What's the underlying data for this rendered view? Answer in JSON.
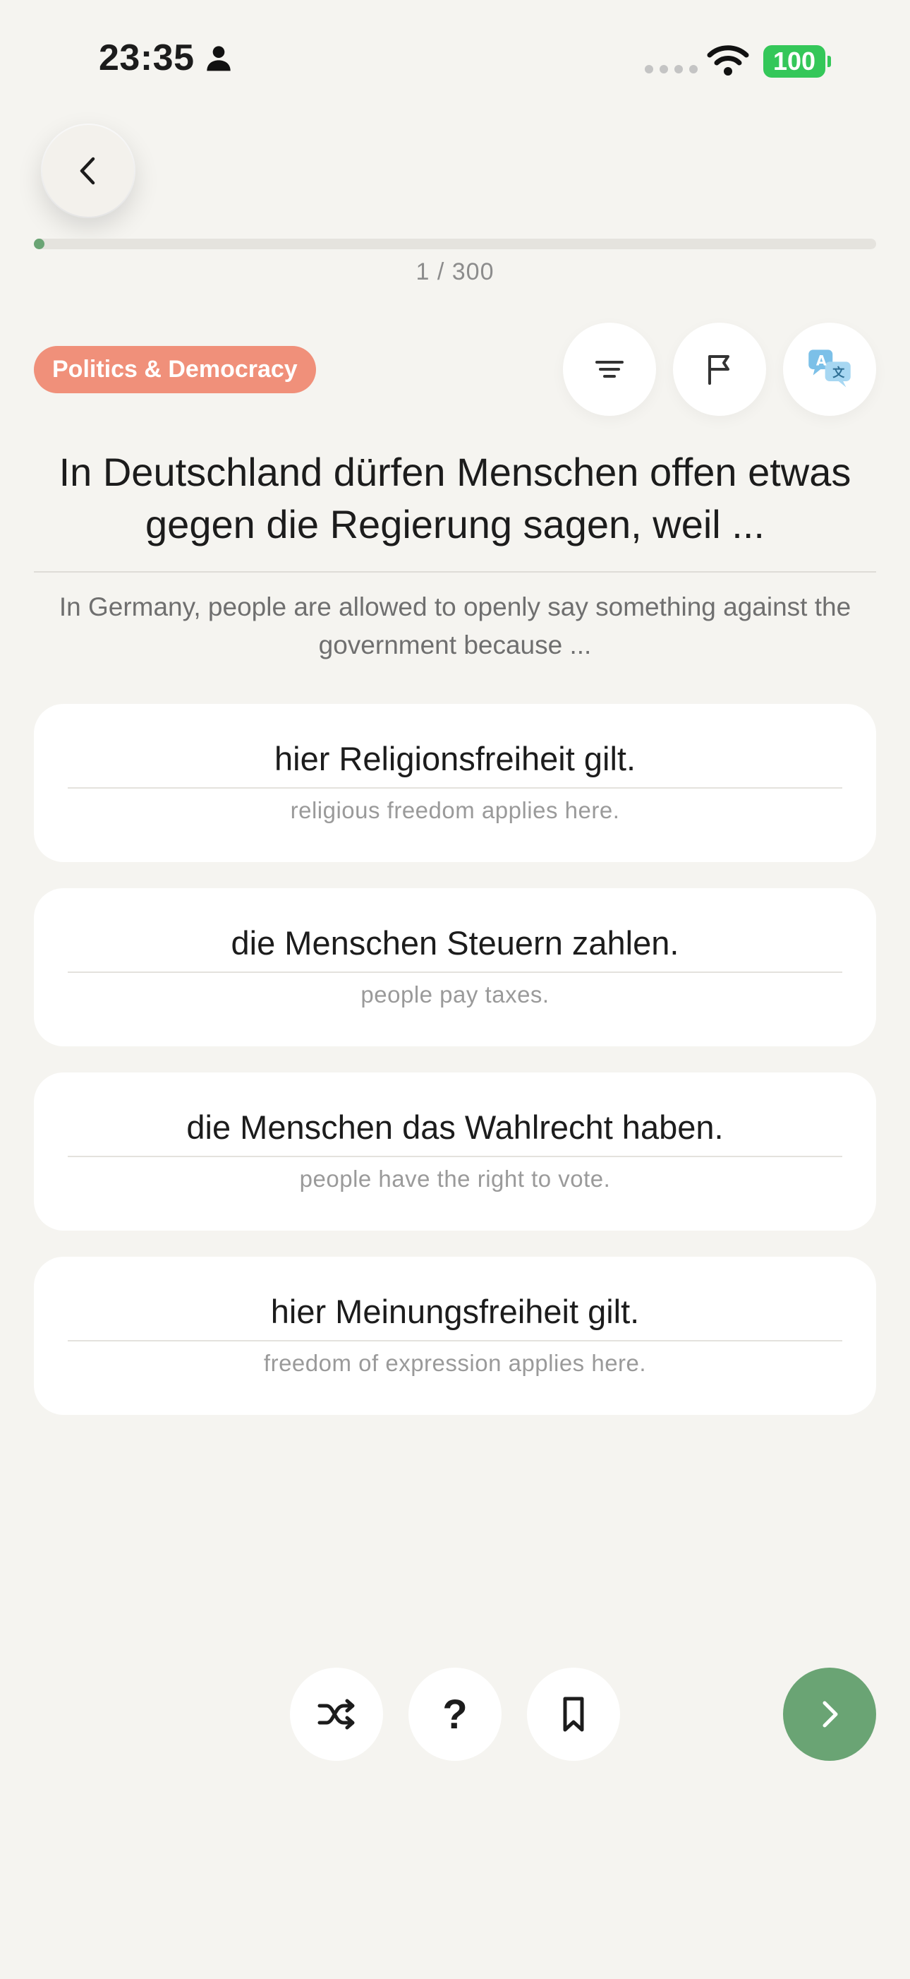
{
  "status_bar": {
    "time": "23:35",
    "battery": "100"
  },
  "progress": {
    "label": "1 / 300",
    "fraction": 0.0033
  },
  "header": {
    "category": "Politics & Democracy"
  },
  "question": {
    "german": "In Deutschland dürfen Menschen offen etwas gegen die Regierung sagen, weil ...",
    "english": "In Germany, people are allowed to openly say something against the government because ..."
  },
  "answers": [
    {
      "german": "hier Religionsfreiheit gilt.",
      "english": "religious freedom applies here."
    },
    {
      "german": "die Menschen Steuern zahlen.",
      "english": "people pay taxes."
    },
    {
      "german": "die Menschen das Wahlrecht haben.",
      "english": "people have the right to vote."
    },
    {
      "german": "hier Meinungsfreiheit gilt.",
      "english": "freedom of expression applies here."
    }
  ],
  "controls": {
    "help_label": "?"
  },
  "icons": {
    "back": "chevron-left-icon",
    "filter": "filter-icon",
    "report": "flag-icon",
    "translate": "translate-icon",
    "shuffle": "shuffle-icon",
    "bookmark": "bookmark-icon",
    "next": "chevron-right-icon"
  },
  "colors": {
    "background": "#f5f4f0",
    "accent_green": "#6aa474",
    "category_badge": "#f0907a",
    "battery": "#34c759"
  }
}
